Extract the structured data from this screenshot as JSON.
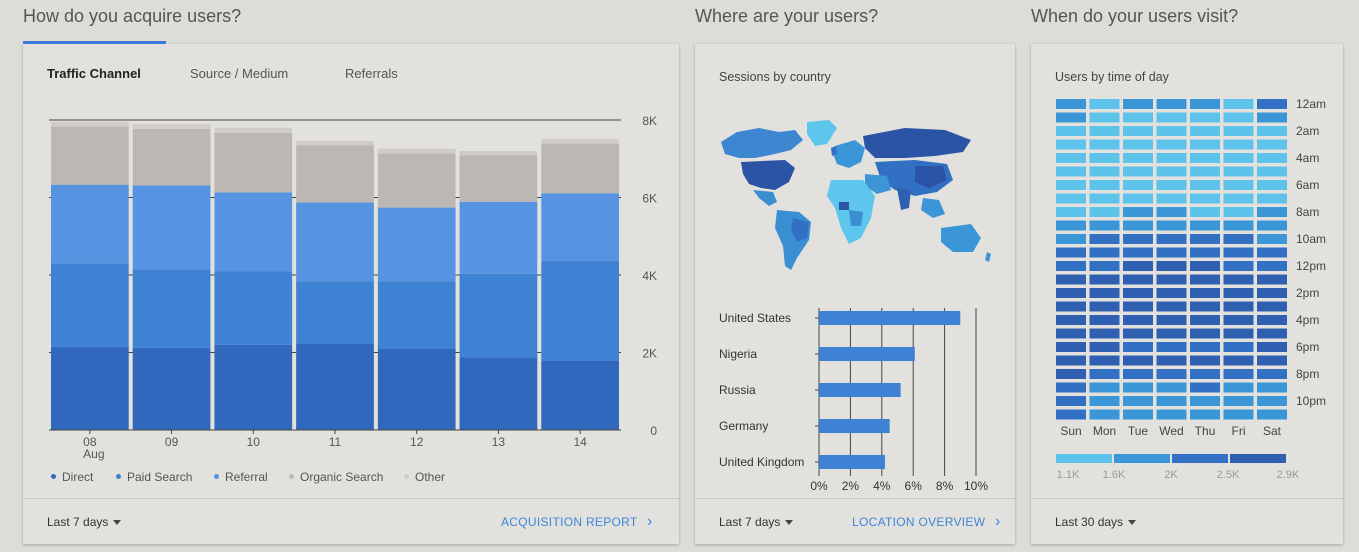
{
  "sections": {
    "acquire_title": "How do you acquire users?",
    "where_title": "Where are your users?",
    "when_title": "When do your users visit?"
  },
  "acquisition": {
    "tabs": [
      {
        "label": "Traffic Channel",
        "active": true
      },
      {
        "label": "Source / Medium",
        "active": false
      },
      {
        "label": "Referrals",
        "active": false
      }
    ],
    "footer_range": "Last 7 days",
    "footer_link": "ACQUISITION REPORT"
  },
  "location": {
    "subtitle": "Sessions by country",
    "footer_range": "Last 7 days",
    "footer_link": "LOCATION OVERVIEW"
  },
  "time": {
    "subtitle": "Users by time of day",
    "footer_range": "Last 30 days"
  },
  "colors": {
    "direct": "#3068be",
    "paid_search": "#3f81d3",
    "referral": "#5694e2",
    "organic_search": "#bbb7b2",
    "other": "#d0cdc9",
    "accent": "#3b78d8",
    "heat_scale": [
      "#5ec3ea",
      "#3a96d6",
      "#3270c4",
      "#2f5fb0"
    ]
  },
  "chart_data": [
    {
      "type": "bar",
      "stacked": true,
      "categories": [
        "08",
        "09",
        "10",
        "11",
        "12",
        "13",
        "14"
      ],
      "category_sublabels": [
        "Aug",
        "",
        "",
        "",
        "",
        "",
        ""
      ],
      "series": [
        {
          "name": "Direct",
          "values": [
            2150,
            2120,
            2200,
            2230,
            2090,
            1870,
            1800
          ]
        },
        {
          "name": "Paid Search",
          "values": [
            2150,
            2030,
            1890,
            1610,
            1750,
            2160,
            2560
          ]
        },
        {
          "name": "Referral",
          "values": [
            2030,
            2160,
            2040,
            2030,
            1900,
            1860,
            1750
          ]
        },
        {
          "name": "Organic Search",
          "values": [
            1500,
            1460,
            1540,
            1480,
            1400,
            1200,
            1280
          ]
        },
        {
          "name": "Other",
          "values": [
            120,
            120,
            130,
            110,
            120,
            110,
            120
          ]
        }
      ],
      "ylim": [
        0,
        8000
      ],
      "yticks": [
        "0",
        "2K",
        "4K",
        "6K",
        "8K"
      ],
      "ytick_values": [
        0,
        2000,
        4000,
        6000,
        8000
      ],
      "legend": "bottom"
    },
    {
      "type": "bar",
      "orientation": "horizontal",
      "categories": [
        "United States",
        "Nigeria",
        "Russia",
        "Germany",
        "United Kingdom"
      ],
      "values": [
        9.0,
        6.1,
        5.2,
        4.5,
        4.2
      ],
      "xlim": [
        0,
        10
      ],
      "xticks": [
        "0%",
        "2%",
        "4%",
        "6%",
        "8%",
        "10%"
      ],
      "xtick_values": [
        0,
        2,
        4,
        6,
        8,
        10
      ]
    },
    {
      "type": "heatmap",
      "columns": [
        "Sun",
        "Mon",
        "Tue",
        "Wed",
        "Thu",
        "Fri",
        "Sat"
      ],
      "row_labels": [
        "12am",
        "2am",
        "4am",
        "6am",
        "8am",
        "10am",
        "12pm",
        "2pm",
        "4pm",
        "6pm",
        "8pm",
        "10pm"
      ],
      "rows": 24,
      "levels": [
        [
          2,
          1,
          2,
          2,
          2,
          1,
          3
        ],
        [
          2,
          1,
          1,
          1,
          1,
          1,
          2
        ],
        [
          1,
          1,
          1,
          1,
          1,
          1,
          1
        ],
        [
          1,
          1,
          1,
          1,
          1,
          1,
          1
        ],
        [
          1,
          1,
          1,
          1,
          1,
          1,
          1
        ],
        [
          1,
          1,
          1,
          1,
          1,
          1,
          1
        ],
        [
          1,
          1,
          1,
          1,
          1,
          1,
          1
        ],
        [
          1,
          1,
          1,
          1,
          1,
          1,
          1
        ],
        [
          1,
          1,
          2,
          2,
          1,
          1,
          2
        ],
        [
          2,
          2,
          2,
          2,
          2,
          2,
          2
        ],
        [
          2,
          3,
          3,
          3,
          3,
          3,
          2
        ],
        [
          3,
          3,
          3,
          3,
          3,
          3,
          3
        ],
        [
          3,
          3,
          4,
          4,
          4,
          3,
          3
        ],
        [
          4,
          4,
          4,
          4,
          4,
          4,
          4
        ],
        [
          4,
          4,
          4,
          4,
          4,
          4,
          4
        ],
        [
          4,
          4,
          4,
          4,
          4,
          4,
          4
        ],
        [
          4,
          4,
          4,
          4,
          4,
          4,
          4
        ],
        [
          4,
          4,
          4,
          4,
          4,
          4,
          4
        ],
        [
          4,
          4,
          3,
          3,
          3,
          3,
          4
        ],
        [
          4,
          4,
          4,
          4,
          4,
          4,
          4
        ],
        [
          4,
          3,
          3,
          3,
          3,
          3,
          3
        ],
        [
          3,
          2,
          2,
          2,
          3,
          2,
          2
        ],
        [
          3,
          2,
          2,
          2,
          2,
          2,
          2
        ],
        [
          3,
          2,
          2,
          2,
          2,
          2,
          2
        ]
      ],
      "scale_labels": [
        "1.1K",
        "1.6K",
        "2K",
        "2.5K",
        "2.9K"
      ]
    }
  ]
}
